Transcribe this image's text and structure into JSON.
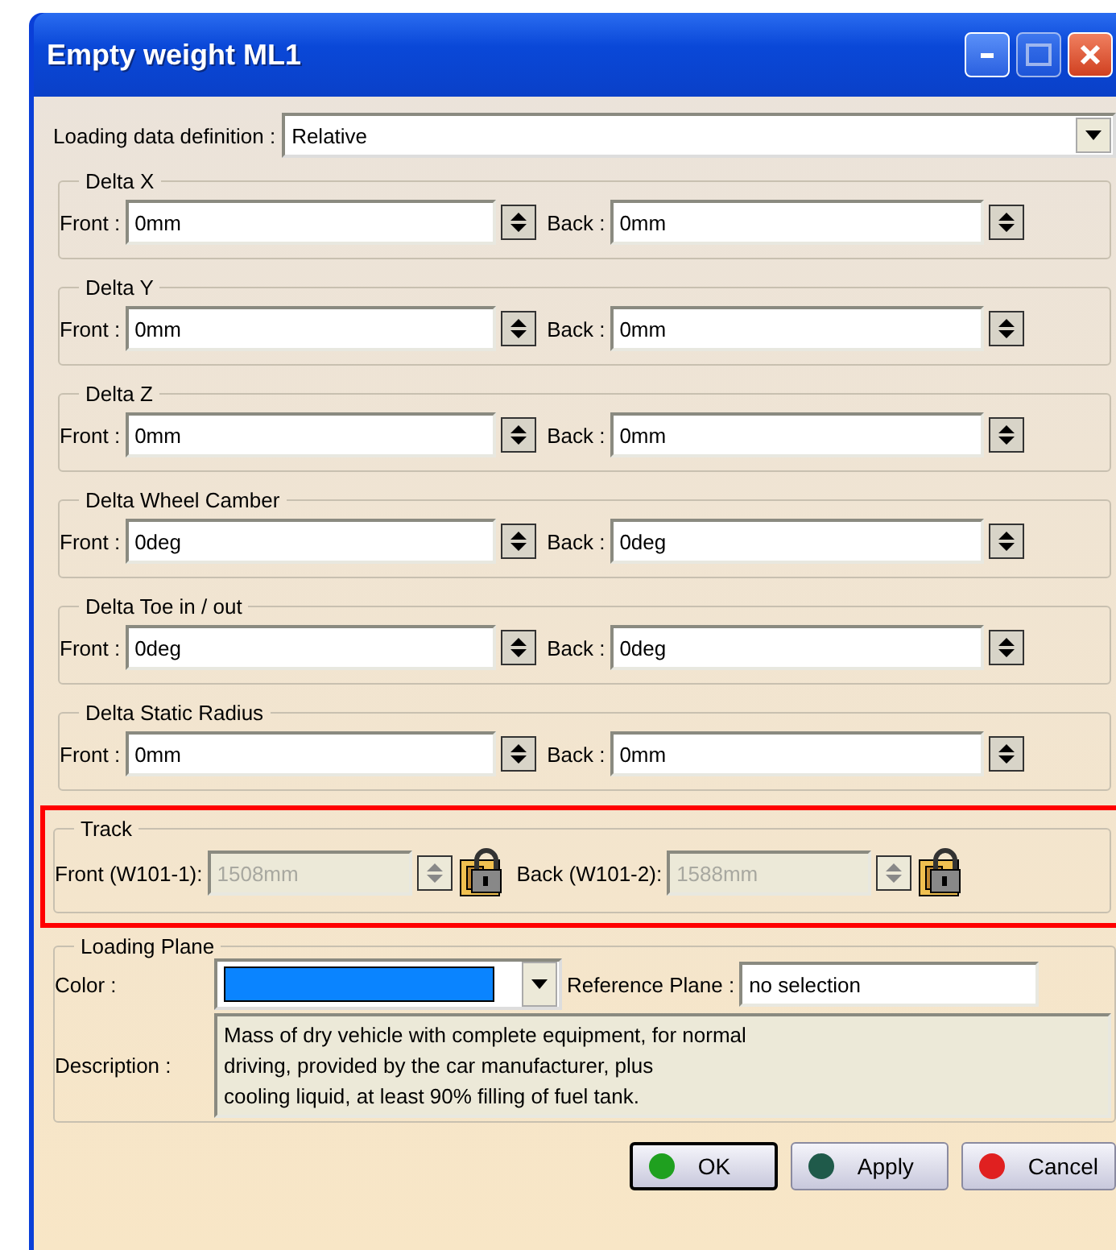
{
  "window": {
    "title": "Empty weight ML1"
  },
  "loading_data_definition": {
    "label": "Loading data definition :",
    "value": "Relative"
  },
  "groups": [
    {
      "title": "Delta X",
      "front_label": "Front :",
      "front_value": "0mm",
      "back_label": "Back :",
      "back_value": "0mm",
      "disabled": false,
      "locked": false,
      "highlighted": false
    },
    {
      "title": "Delta Y",
      "front_label": "Front :",
      "front_value": "0mm",
      "back_label": "Back :",
      "back_value": "0mm",
      "disabled": false,
      "locked": false,
      "highlighted": false
    },
    {
      "title": "Delta Z",
      "front_label": "Front :",
      "front_value": "0mm",
      "back_label": "Back :",
      "back_value": "0mm",
      "disabled": false,
      "locked": false,
      "highlighted": false
    },
    {
      "title": "Delta Wheel Camber",
      "front_label": "Front :",
      "front_value": "0deg",
      "back_label": "Back :",
      "back_value": "0deg",
      "disabled": false,
      "locked": false,
      "highlighted": false
    },
    {
      "title": "Delta Toe in / out",
      "front_label": "Front :",
      "front_value": "0deg",
      "back_label": "Back :",
      "back_value": "0deg",
      "disabled": false,
      "locked": false,
      "highlighted": false
    },
    {
      "title": "Delta Static Radius",
      "front_label": "Front :",
      "front_value": "0mm",
      "back_label": "Back :",
      "back_value": "0mm",
      "disabled": false,
      "locked": false,
      "highlighted": false
    },
    {
      "title": "Track",
      "front_label": "Front (W101-1):",
      "front_value": "1508mm",
      "back_label": "Back (W101-2):",
      "back_value": "1588mm",
      "disabled": true,
      "locked": true,
      "highlighted": true
    }
  ],
  "loading_plane": {
    "title": "Loading Plane",
    "color_label": "Color :",
    "color": "#0a84ff",
    "reference_label": "Reference Plane :",
    "reference_value": "no selection",
    "description_label": "Description :",
    "description_lines": [
      "Mass of dry vehicle with complete equipment, for normal",
      "driving, provided by the car manufacturer, plus",
      "cooling liquid, at least 90% filling of fuel tank."
    ]
  },
  "buttons": [
    {
      "label": "OK",
      "color": "#1fa01f",
      "default": true
    },
    {
      "label": "Apply",
      "color": "#1f5a4a",
      "default": false
    },
    {
      "label": "Cancel",
      "color": "#e02020",
      "default": false
    }
  ]
}
